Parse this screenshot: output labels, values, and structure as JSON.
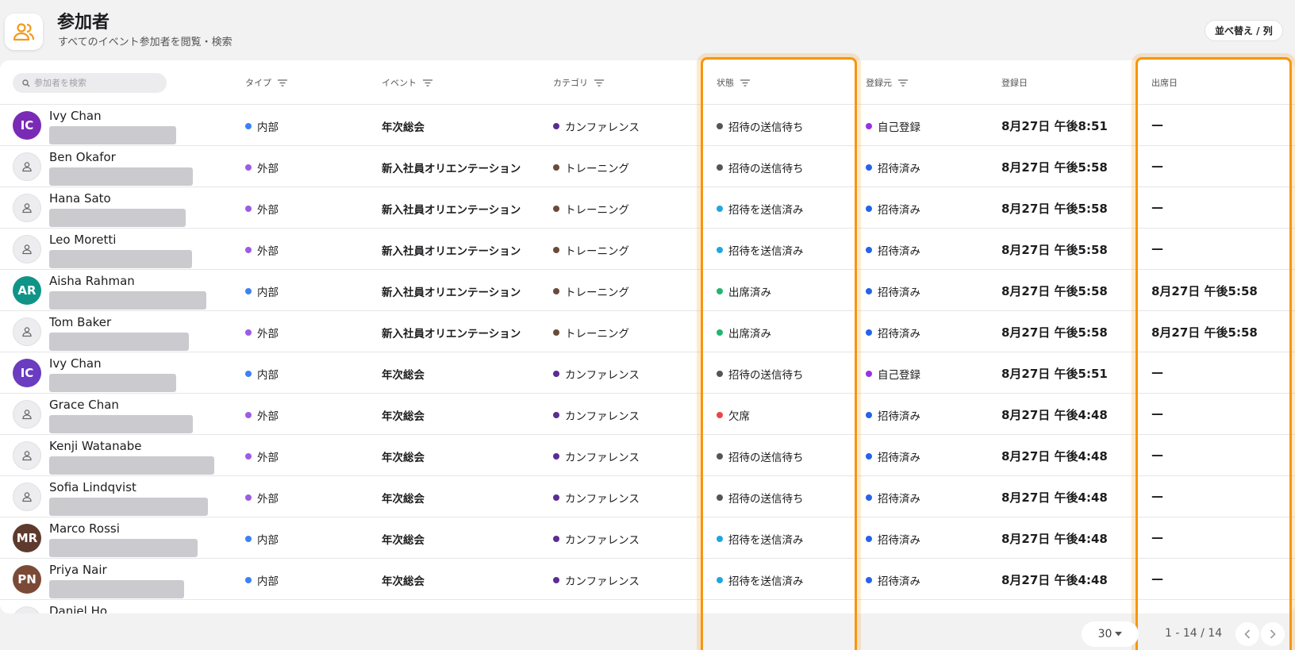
{
  "header": {
    "icon": "people-icon",
    "title": "参加者",
    "subtitle": "すべてのイベント参加者を閲覧・検索",
    "sort_button": "並べ替え / 列"
  },
  "search": {
    "placeholder": "参加者を検索"
  },
  "columns": {
    "type": "タイプ",
    "event": "イベント",
    "category": "カテゴリ",
    "status": "状態",
    "source": "登録元",
    "registered": "登録日",
    "attended": "出席日"
  },
  "colors": {
    "accent_orange": "#f7960f",
    "internal": "#3b82f6",
    "external": "#9b5de5",
    "conference": "#5b2d91",
    "training": "#6b4a3a",
    "pending": "#555555",
    "sent": "#1ea7e1",
    "attended": "#22b573",
    "absent": "#ef4444",
    "self_reg": "#9b30e5",
    "invited": "#2563eb"
  },
  "rows": [
    {
      "name": "Ivy Chan",
      "initials": "IC",
      "avatar_color": "#7a2bb5",
      "type": "内部",
      "type_color": "#3b82f6",
      "event": "年次総会",
      "category": "カンファレンス",
      "category_color": "#5b2d91",
      "status": "招待の送信待ち",
      "status_color": "#555555",
      "source": "自己登録",
      "source_color": "#9b30e5",
      "registered": "8月27日 午後8:51",
      "attended": "—"
    },
    {
      "name": "Ben Okafor",
      "initials": "",
      "avatar_color": "",
      "type": "外部",
      "type_color": "#9b5de5",
      "event": "新入社員オリエンテーション",
      "category": "トレーニング",
      "category_color": "#6b4a3a",
      "status": "招待の送信待ち",
      "status_color": "#555555",
      "source": "招待済み",
      "source_color": "#2563eb",
      "registered": "8月27日 午後5:58",
      "attended": "—"
    },
    {
      "name": "Hana Sato",
      "initials": "",
      "avatar_color": "",
      "type": "外部",
      "type_color": "#9b5de5",
      "event": "新入社員オリエンテーション",
      "category": "トレーニング",
      "category_color": "#6b4a3a",
      "status": "招待を送信済み",
      "status_color": "#1ea7e1",
      "source": "招待済み",
      "source_color": "#2563eb",
      "registered": "8月27日 午後5:58",
      "attended": "—"
    },
    {
      "name": "Leo Moretti",
      "initials": "",
      "avatar_color": "",
      "type": "外部",
      "type_color": "#9b5de5",
      "event": "新入社員オリエンテーション",
      "category": "トレーニング",
      "category_color": "#6b4a3a",
      "status": "招待を送信済み",
      "status_color": "#1ea7e1",
      "source": "招待済み",
      "source_color": "#2563eb",
      "registered": "8月27日 午後5:58",
      "attended": "—"
    },
    {
      "name": "Aisha Rahman",
      "initials": "AR",
      "avatar_color": "#119488",
      "type": "内部",
      "type_color": "#3b82f6",
      "event": "新入社員オリエンテーション",
      "category": "トレーニング",
      "category_color": "#6b4a3a",
      "status": "出席済み",
      "status_color": "#22b573",
      "source": "招待済み",
      "source_color": "#2563eb",
      "registered": "8月27日 午後5:58",
      "attended": "8月27日 午後5:58"
    },
    {
      "name": "Tom Baker",
      "initials": "",
      "avatar_color": "",
      "type": "外部",
      "type_color": "#9b5de5",
      "event": "新入社員オリエンテーション",
      "category": "トレーニング",
      "category_color": "#6b4a3a",
      "status": "出席済み",
      "status_color": "#22b573",
      "source": "招待済み",
      "source_color": "#2563eb",
      "registered": "8月27日 午後5:58",
      "attended": "8月27日 午後5:58"
    },
    {
      "name": "Ivy Chan",
      "initials": "IC",
      "avatar_color": "#6a3cc0",
      "type": "内部",
      "type_color": "#3b82f6",
      "event": "年次総会",
      "category": "カンファレンス",
      "category_color": "#5b2d91",
      "status": "招待の送信待ち",
      "status_color": "#555555",
      "source": "自己登録",
      "source_color": "#9b30e5",
      "registered": "8月27日 午後5:51",
      "attended": "—"
    },
    {
      "name": "Grace Chan",
      "initials": "",
      "avatar_color": "",
      "type": "外部",
      "type_color": "#9b5de5",
      "event": "年次総会",
      "category": "カンファレンス",
      "category_color": "#5b2d91",
      "status": "欠席",
      "status_color": "#ef4444",
      "source": "招待済み",
      "source_color": "#2563eb",
      "registered": "8月27日 午後4:48",
      "attended": "—"
    },
    {
      "name": "Kenji Watanabe",
      "initials": "",
      "avatar_color": "",
      "type": "外部",
      "type_color": "#9b5de5",
      "event": "年次総会",
      "category": "カンファレンス",
      "category_color": "#5b2d91",
      "status": "招待の送信待ち",
      "status_color": "#555555",
      "source": "招待済み",
      "source_color": "#2563eb",
      "registered": "8月27日 午後4:48",
      "attended": "—"
    },
    {
      "name": "Sofia Lindqvist",
      "initials": "",
      "avatar_color": "",
      "type": "外部",
      "type_color": "#9b5de5",
      "event": "年次総会",
      "category": "カンファレンス",
      "category_color": "#5b2d91",
      "status": "招待の送信待ち",
      "status_color": "#555555",
      "source": "招待済み",
      "source_color": "#2563eb",
      "registered": "8月27日 午後4:48",
      "attended": "—"
    },
    {
      "name": "Marco Rossi",
      "initials": "MR",
      "avatar_color": "#5e3a2e",
      "type": "内部",
      "type_color": "#3b82f6",
      "event": "年次総会",
      "category": "カンファレンス",
      "category_color": "#5b2d91",
      "status": "招待を送信済み",
      "status_color": "#1ea7e1",
      "source": "招待済み",
      "source_color": "#2563eb",
      "registered": "8月27日 午後4:48",
      "attended": "—"
    },
    {
      "name": "Priya Nair",
      "initials": "PN",
      "avatar_color": "#7a4a36",
      "type": "内部",
      "type_color": "#3b82f6",
      "event": "年次総会",
      "category": "カンファレンス",
      "category_color": "#5b2d91",
      "status": "招待を送信済み",
      "status_color": "#1ea7e1",
      "source": "招待済み",
      "source_color": "#2563eb",
      "registered": "8月27日 午後4:48",
      "attended": "—"
    },
    {
      "name": "Daniel Ho",
      "initials": "",
      "avatar_color": "",
      "type": "",
      "type_color": "",
      "event": "",
      "category": "",
      "category_color": "",
      "status": "",
      "status_color": "",
      "source": "",
      "source_color": "",
      "registered": "",
      "attended": ""
    }
  ],
  "footer": {
    "page_size": "30",
    "range": "1 - 14 / 14"
  }
}
